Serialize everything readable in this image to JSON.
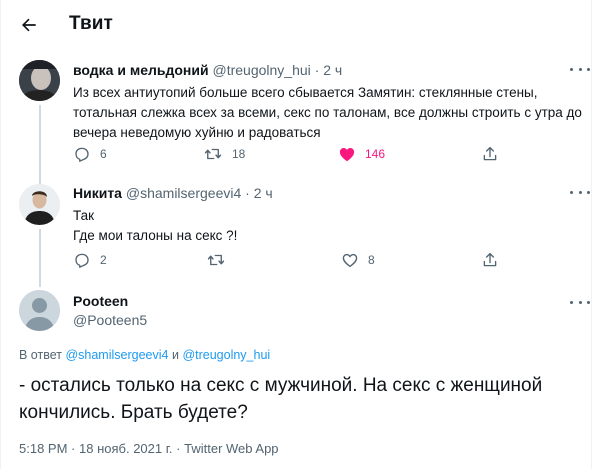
{
  "header": {
    "title": "Твит"
  },
  "thread": [
    {
      "display_name": "водка и мельдоний",
      "handle": "@treugolny_hui",
      "dot": "·",
      "time": "2 ч",
      "lines": [
        "Из всех антиутопий больше всего сбывается Замятин: стеклянные стены,",
        "тотальная слежка всех за всеми, секс по талонам, все должны строить с утра до",
        "вечера неведомую хуйню и радоваться"
      ],
      "replies": "6",
      "retweets": "18",
      "likes": "146",
      "liked": true
    },
    {
      "display_name": "Никита",
      "handle": "@shamilsergeevi4",
      "dot": "·",
      "time": "2 ч",
      "lines": [
        "Так",
        "Где мои талоны на секс ?!"
      ],
      "replies": "2",
      "retweets": "",
      "likes": "8",
      "liked": false
    }
  ],
  "main_tweet": {
    "display_name": "Pooteen",
    "handle": "@Pooteen5",
    "reply_prefix": "В ответ",
    "reply_user_1": "@shamilsergeevi4",
    "reply_and": "и",
    "reply_user_2": "@treugolny_hui",
    "text": "- остались только на секс с мужчиной. На секс с женщиной кончились. Брать будете?",
    "time": "5:18 PM",
    "date": "18 нояб. 2021 г.",
    "sep": "·",
    "source": "Twitter Web App"
  },
  "colors": {
    "like_active": "#f91880",
    "link": "#1d9bf0",
    "secondary_text": "#536471"
  }
}
